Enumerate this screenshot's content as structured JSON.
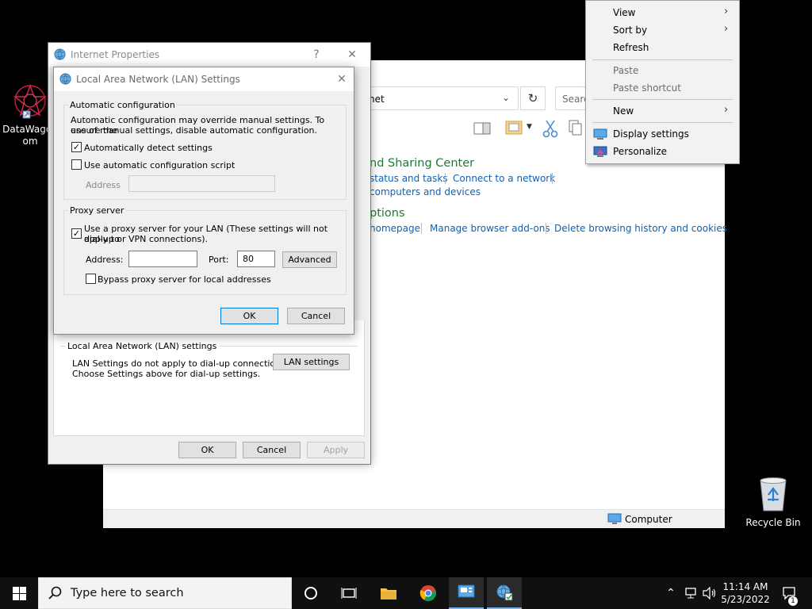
{
  "desktop": {
    "icons": [
      {
        "label_line1": "DataWagon",
        "label_line2": "om"
      },
      {
        "label": "Recycle Bin"
      }
    ]
  },
  "control_panel": {
    "address_text": "net",
    "search_placeholder": "Searc",
    "heading_network": "nd Sharing Center",
    "link_status": "status and tasks",
    "link_connect": "Connect to a network",
    "link_computers": "computers and devices",
    "heading_options": "ptions",
    "link_homepage": "homepage",
    "link_addons": "Manage browser add-ons",
    "link_history": "Delete browsing history and cookies",
    "status_text": "Computer"
  },
  "internet_properties": {
    "title": "Internet Properties",
    "help": "?",
    "close": "✕",
    "lan_group_label": "Local Area Network (LAN) settings",
    "lan_desc_line1": "LAN Settings do not apply to dial-up connections.",
    "lan_desc_line2": "Choose Settings above for dial-up settings.",
    "lan_button": "LAN settings",
    "ok": "OK",
    "cancel": "Cancel",
    "apply": "Apply"
  },
  "lan_dialog": {
    "title": "Local Area Network (LAN) Settings",
    "close": "✕",
    "auto_group": "Automatic configuration",
    "auto_desc_line1": "Automatic configuration may override manual settings.  To ensure the",
    "auto_desc_line2": "use of manual settings, disable automatic configuration.",
    "auto_detect_label": "Automatically detect settings",
    "auto_detect_checked": true,
    "auto_script_label": "Use automatic configuration script",
    "auto_script_checked": false,
    "script_address_label": "Address",
    "script_address_value": "",
    "proxy_group": "Proxy server",
    "use_proxy_line1": "Use a proxy server for your LAN (These settings will not apply to",
    "use_proxy_line2": "dial-up or VPN connections).",
    "use_proxy_checked": true,
    "proxy_address_label": "Address:",
    "proxy_address_value": "",
    "port_label": "Port:",
    "port_value": "80",
    "advanced_button": "Advanced",
    "bypass_label": "Bypass proxy server for local addresses",
    "bypass_checked": false,
    "ok": "OK",
    "cancel": "Cancel"
  },
  "context_menu": {
    "view": "View",
    "sort_by": "Sort by",
    "refresh": "Refresh",
    "paste": "Paste",
    "paste_shortcut": "Paste shortcut",
    "new": "New",
    "display_settings": "Display settings",
    "personalize": "Personalize"
  },
  "taskbar": {
    "search_placeholder": "Type here to search",
    "time": "11:14 AM",
    "date": "5/23/2022",
    "notification_count": "1"
  },
  "colors": {
    "link_blue": "#1160b0",
    "heading_green": "#1e7a33",
    "dialog_bg": "#f0f0f0",
    "taskbar_bg": "#101010",
    "accent": "#0078d7"
  }
}
